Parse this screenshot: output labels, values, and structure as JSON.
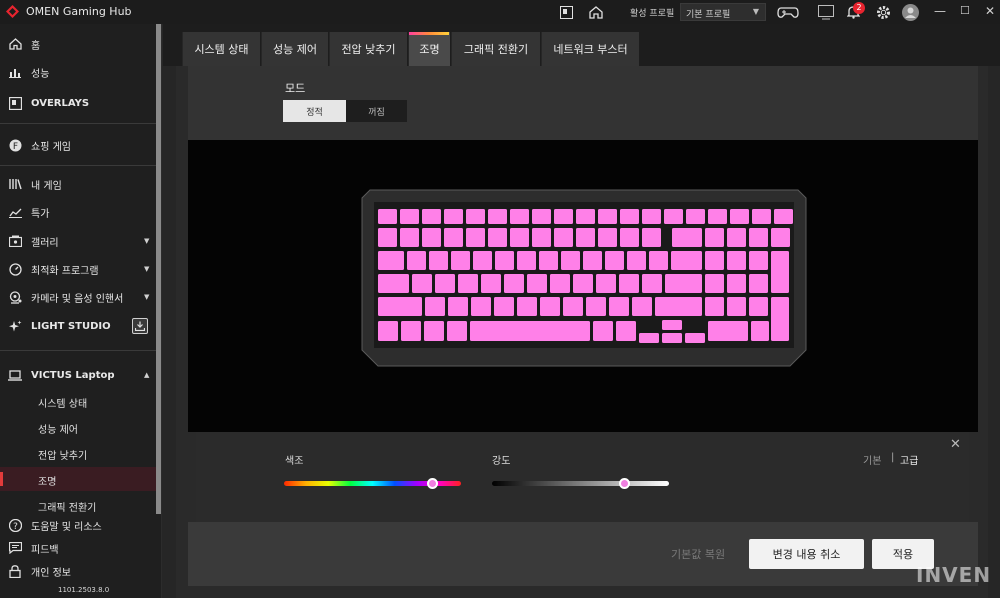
{
  "titlebar": {
    "app_title": "OMEN Gaming Hub",
    "profile_label": "활성 프로필",
    "profile_value": "기본 프로필",
    "notification_count": "2",
    "icons": [
      "omen-logo-icon",
      "widget-icon",
      "home-icon",
      "game-controller-icon",
      "screen-icon",
      "bell-icon",
      "gear-icon",
      "avatar-icon"
    ]
  },
  "sidebar": {
    "items": [
      {
        "label": "홈",
        "icon": "home-icon"
      },
      {
        "label": "성능",
        "icon": "chart-icon"
      },
      {
        "label": "OVERLAYS",
        "icon": "overlay-icon"
      },
      {
        "label": "쇼핑 게임",
        "icon": "shop-icon"
      },
      {
        "label": "내 게임",
        "icon": "library-icon"
      },
      {
        "label": "특가",
        "icon": "trend-icon"
      },
      {
        "label": "갤러리",
        "icon": "gallery-icon"
      },
      {
        "label": "최적화 프로그램",
        "icon": "speed-icon"
      },
      {
        "label": "카메라 및 음성 인핸서",
        "icon": "webcam-icon"
      },
      {
        "label": "LIGHT STUDIO",
        "icon": "sparkle-icon"
      },
      {
        "label": "VICTUS Laptop",
        "icon": "laptop-icon"
      }
    ],
    "subitems": [
      "시스템 상태",
      "성능 제어",
      "전압 낮추기",
      "조명",
      "그래픽 전환기"
    ],
    "footer_items": [
      {
        "label": "도움말 및 리소스",
        "icon": "help-icon"
      },
      {
        "label": "피드백",
        "icon": "feedback-icon"
      },
      {
        "label": "개인 정보",
        "icon": "lock-icon"
      }
    ],
    "version": "1101.2503.8.0"
  },
  "tabs": [
    "시스템 상태",
    "성능 제어",
    "전압 낮추기",
    "조명",
    "그래픽 전환기",
    "네트워크 부스터"
  ],
  "mode": {
    "label": "모드",
    "options": [
      "정적",
      "꺼짐"
    ],
    "selected": "정적"
  },
  "keyboard": {
    "key_color": "#ff80e8"
  },
  "color_panel": {
    "hue_label": "색조",
    "intensity_label": "강도",
    "hue_value": 0.84,
    "intensity_value": 0.75,
    "mode_basic": "기본",
    "mode_divider": "|",
    "mode_advanced": "고급",
    "selected_color": "#f07fe0"
  },
  "footer": {
    "restore_defaults": "기본값 복원",
    "cancel": "변경 내용 취소",
    "apply": "적용"
  },
  "watermark": "INVEN"
}
